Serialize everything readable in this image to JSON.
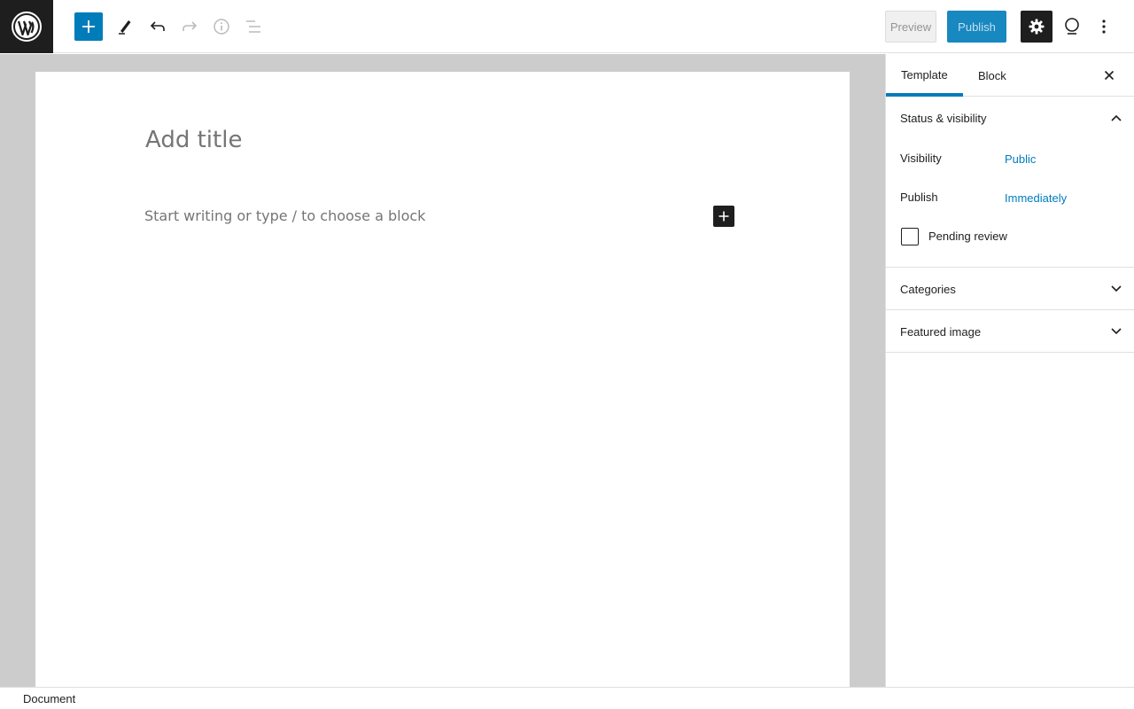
{
  "toolbar": {
    "add_block_tooltip": "Add block",
    "preview_label": "Preview",
    "publish_label": "Publish",
    "icons": [
      "wordpress-logo-icon",
      "plus-icon",
      "pencil-icon",
      "undo-icon",
      "redo-icon",
      "info-icon",
      "list-view-icon",
      "gear-icon",
      "plugin-icon",
      "more-vertical-icon"
    ]
  },
  "editor": {
    "title_placeholder": "Add title",
    "paragraph_placeholder": "Start writing or type / to choose a block"
  },
  "sidebar": {
    "tabs": [
      {
        "label": "Template",
        "active": true
      },
      {
        "label": "Block",
        "active": false
      }
    ],
    "status_panel": {
      "title": "Status & visibility",
      "expanded": true,
      "visibility_label": "Visibility",
      "visibility_value": "Public",
      "publish_label": "Publish",
      "publish_value": "Immediately",
      "pending_review_label": "Pending review",
      "pending_review_checked": false
    },
    "categories_panel": {
      "title": "Categories",
      "expanded": false
    },
    "featured_image_panel": {
      "title": "Featured image",
      "expanded": false
    }
  },
  "footer": {
    "breadcrumb": "Document"
  },
  "colors": {
    "accent": "#007cba",
    "dark": "#1e1e1e",
    "canvas_bg": "#cccccc"
  }
}
